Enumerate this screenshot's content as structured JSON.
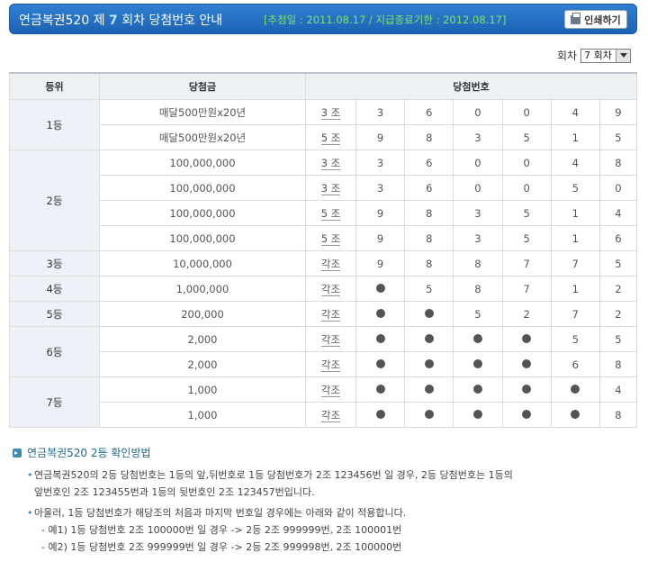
{
  "header": {
    "title_pre": "연금복권520 제 ",
    "round": "7",
    "title_post": " 회차 당첨번호 안내",
    "dates": "[추첨일 : 2011.08.17 / 지급종료기한 : 2012.08.17]",
    "print_label": "인쇄하기",
    "print_icon": "printer-icon"
  },
  "round_select": {
    "label": "회차",
    "value": "7 회차"
  },
  "table": {
    "headers": [
      "등위",
      "당첨금",
      "당첨번호"
    ],
    "groups": [
      {
        "rank": "1등",
        "rows": [
          {
            "prize": "매달500만원x20년",
            "jo": "3 조",
            "nums": [
              "3",
              "6",
              "0",
              "0",
              "4",
              "9"
            ]
          },
          {
            "prize": "매달500만원x20년",
            "jo": "5 조",
            "nums": [
              "9",
              "8",
              "3",
              "5",
              "1",
              "5"
            ]
          }
        ]
      },
      {
        "rank": "2등",
        "rows": [
          {
            "prize": "100,000,000",
            "jo": "3 조",
            "nums": [
              "3",
              "6",
              "0",
              "0",
              "4",
              "8"
            ]
          },
          {
            "prize": "100,000,000",
            "jo": "3 조",
            "nums": [
              "3",
              "6",
              "0",
              "0",
              "5",
              "0"
            ]
          },
          {
            "prize": "100,000,000",
            "jo": "5 조",
            "nums": [
              "9",
              "8",
              "3",
              "5",
              "1",
              "4"
            ]
          },
          {
            "prize": "100,000,000",
            "jo": "5 조",
            "nums": [
              "9",
              "8",
              "3",
              "5",
              "1",
              "6"
            ]
          }
        ]
      },
      {
        "rank": "3등",
        "rows": [
          {
            "prize": "10,000,000",
            "jo": "각조",
            "nums": [
              "9",
              "8",
              "8",
              "7",
              "7",
              "5"
            ]
          }
        ]
      },
      {
        "rank": "4등",
        "rows": [
          {
            "prize": "1,000,000",
            "jo": "각조",
            "nums": [
              "●",
              "5",
              "8",
              "7",
              "1",
              "2"
            ]
          }
        ]
      },
      {
        "rank": "5등",
        "rows": [
          {
            "prize": "200,000",
            "jo": "각조",
            "nums": [
              "●",
              "●",
              "5",
              "2",
              "7",
              "2"
            ]
          }
        ]
      },
      {
        "rank": "6등",
        "rows": [
          {
            "prize": "2,000",
            "jo": "각조",
            "nums": [
              "●",
              "●",
              "●",
              "●",
              "5",
              "5"
            ]
          },
          {
            "prize": "2,000",
            "jo": "각조",
            "nums": [
              "●",
              "●",
              "●",
              "●",
              "6",
              "8"
            ]
          }
        ]
      },
      {
        "rank": "7등",
        "rows": [
          {
            "prize": "1,000",
            "jo": "각조",
            "nums": [
              "●",
              "●",
              "●",
              "●",
              "●",
              "4"
            ]
          },
          {
            "prize": "1,000",
            "jo": "각조",
            "nums": [
              "●",
              "●",
              "●",
              "●",
              "●",
              "8"
            ]
          }
        ]
      }
    ]
  },
  "info": {
    "title": "연금복권520 2등 확인방법",
    "p1_line1": "연금복권520의 2등 당첨번호는 1등의 앞,뒤번호로 1등 당첨번호가 2조 123456번 일 경우, 2등 당첨번호는 1등의",
    "p1_line2": "앞번호인 2조 123455번과 1등의 뒷번호인 2조 123457번입니다.",
    "p2_line1": "아울러, 1등 당첨번호가 해당조의 처음과 마지막 번호일 경우에는 아래와 같이 적용합니다.",
    "ex1": "- 예1) 1등 당첨번호 2조 100000번 일 경우 -> 2등 2조 999999번, 2조 100001번",
    "ex2": "- 예2) 1등 당첨번호 2조 999999번 일 경우 -> 2등 2조 999998번, 2조 100000번"
  }
}
